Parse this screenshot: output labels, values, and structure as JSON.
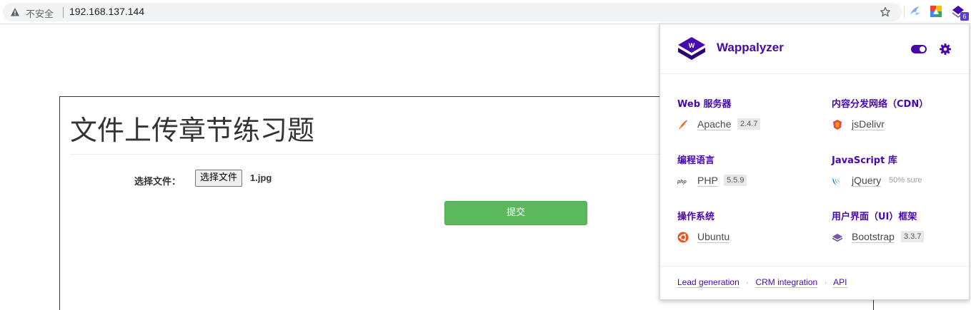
{
  "browser": {
    "insecure_label": "不安全",
    "url": "192.168.137.144",
    "extension_badge": "6"
  },
  "page": {
    "title": "文件上传章节练习题",
    "file_label": "选择文件：",
    "file_button": "选择文件",
    "file_name": "1.jpg",
    "submit_label": "提交"
  },
  "wappalyzer": {
    "brand": "Wappalyzer",
    "categories": [
      {
        "title": "Web 服务器",
        "tech": "Apache",
        "version": "2.4.7",
        "confidence": "",
        "icon": "apache-feather-icon"
      },
      {
        "title": "内容分发网络（CDN）",
        "tech": "jsDelivr",
        "version": "",
        "confidence": "",
        "icon": "jsdelivr-icon"
      },
      {
        "title": "编程语言",
        "tech": "PHP",
        "version": "5.5.9",
        "confidence": "",
        "icon": "php-icon"
      },
      {
        "title": "JavaScript 库",
        "tech": "jQuery",
        "version": "",
        "confidence": "50% sure",
        "icon": "jquery-icon"
      },
      {
        "title": "操作系统",
        "tech": "Ubuntu",
        "version": "",
        "confidence": "",
        "icon": "ubuntu-icon"
      },
      {
        "title": "用户界面（UI）框架",
        "tech": "Bootstrap",
        "version": "3.3.7",
        "confidence": "",
        "icon": "bootstrap-icon"
      }
    ],
    "footer": {
      "links": [
        "Lead generation",
        "CRM integration",
        "API"
      ]
    }
  },
  "colors": {
    "brand_purple": "#4608ad",
    "submit_green": "#5cb85c"
  }
}
